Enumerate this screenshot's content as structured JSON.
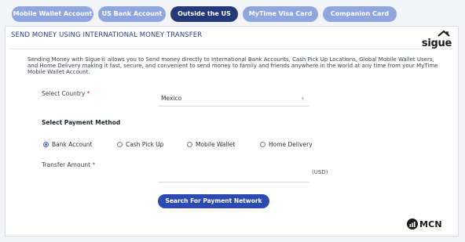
{
  "tabs": [
    {
      "label": "Mobile Wallet Account",
      "active": false
    },
    {
      "label": "US Bank Account",
      "active": false
    },
    {
      "label": "Outside the US",
      "active": true
    },
    {
      "label": "MyTime  Visa Card",
      "active": false
    },
    {
      "label": "Companion Card",
      "active": false
    }
  ],
  "panel": {
    "title": "SEND MONEY USING INTERNATIONAL MONEY TRANSFER",
    "brand_logo": "sigue",
    "description": "Sending Money with Sigue® allows you to Send money directly to International Bank Accounts, Cash Pick Up Locations, Global Mobile Wallet Users, and Home Delivery making it fast, secure, and convenient to send money to family and friends anywhere in the world at any time from your MyTime Mobile Wallet Account."
  },
  "country": {
    "label": "Select Country",
    "required_mark": "*",
    "value": "Mexico",
    "icon": "chevron-down-icon"
  },
  "payment_method": {
    "label": "Select Payment Method",
    "options": [
      {
        "label": "Bank Account",
        "checked": true
      },
      {
        "label": "Cash Pick Up",
        "checked": false
      },
      {
        "label": "Mobile Wallet",
        "checked": false
      },
      {
        "label": "Home Delivery",
        "checked": false
      }
    ]
  },
  "amount": {
    "label": "Transfer Amount",
    "required_mark": "*",
    "value": "",
    "currency": "(USD)"
  },
  "actions": {
    "search_label": "Search For Payment Network"
  },
  "footer": {
    "brand": "MCN"
  },
  "colors": {
    "tab_inactive": "#8fa6df",
    "tab_active": "#243a78",
    "button": "#2b4bb0",
    "title": "#2a3e7c",
    "required": "#e03a3a",
    "radio_checked": "#3763d6"
  }
}
